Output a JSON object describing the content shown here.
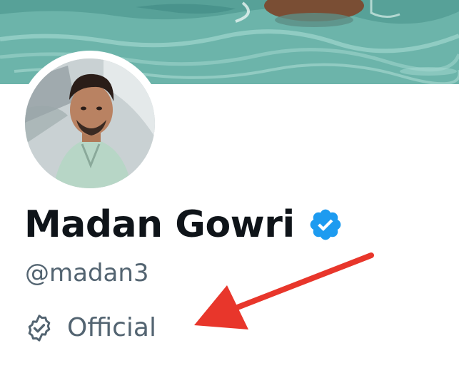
{
  "profile": {
    "display_name": "Madan Gowri",
    "handle": "@madan3",
    "label": "Official"
  },
  "icons": {
    "verified": "verified-badge-icon",
    "official": "official-label-icon"
  },
  "colors": {
    "verified_blue": "#1d9bf0",
    "name_text": "#0f1419",
    "secondary_text": "#536471",
    "annotation_arrow": "#e8362b"
  }
}
